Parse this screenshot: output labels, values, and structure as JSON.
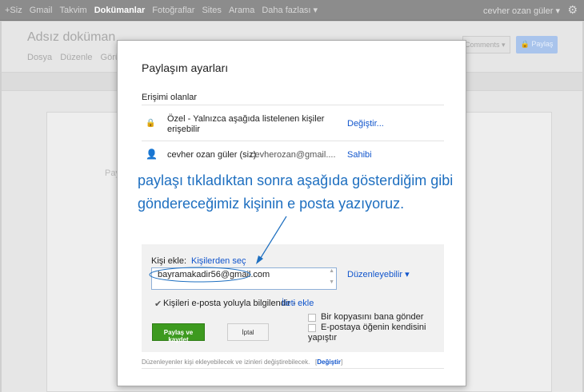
{
  "topbar": {
    "items": [
      "+Siz",
      "Gmail",
      "Takvim",
      "Dokümanlar",
      "Fotoğraflar",
      "Sites",
      "Arama",
      "Daha fazlası ▾"
    ],
    "active": "Dokümanlar",
    "user": "cevher ozan güler ▾"
  },
  "doc": {
    "title": "Adsız doküman",
    "menu": [
      "Dosya",
      "Düzenle",
      "Görün"
    ],
    "comments": "Comments ▾",
    "share": "🔒 Paylaş",
    "page_text": "Pay"
  },
  "dialog": {
    "title": "Paylaşım ayarları",
    "access_heading": "Erişimi olanlar",
    "privacy": "Özel - Yalnızca aşağıda listelenen kişiler erişebilir",
    "privacy_line1": "Özel - Yalnızca aşağıda listelenen kişiler",
    "privacy_line2": "erişebilir",
    "change": "Değiştir...",
    "owner_name": "cevher ozan güler (siz)",
    "owner_email": "cevherozan@gmail....",
    "owner_role": "Sahibi",
    "add_label": "Kişi ekle:",
    "pick_contacts": "Kişilerden seç",
    "email_value": "bayramakadir56@gmail.com",
    "permission": "Düzenleyebilir ▾",
    "notify": "Kişileri e-posta yoluyla bilgilendir -",
    "add_message": "İleti ekle",
    "send_copy": "Bir kopyasını bana gönder",
    "paste_line1": "E-postaya öğenin kendisini",
    "paste_line2": "yapıştır",
    "share_save": "Paylaş ve kaydet",
    "cancel": "İptal",
    "footer": "Düzenleyenler kişi ekleyebilecek ve izinleri değiştirebilecek.",
    "footer_link": "Değiştir"
  },
  "annotation": {
    "line1": "paylaşı tıkladıktan sonra aşağıda gösterdiğim gibi",
    "line2": "göndereceğimiz kişinin e posta yazıyoruz.",
    "color": "#1e6fc0"
  }
}
